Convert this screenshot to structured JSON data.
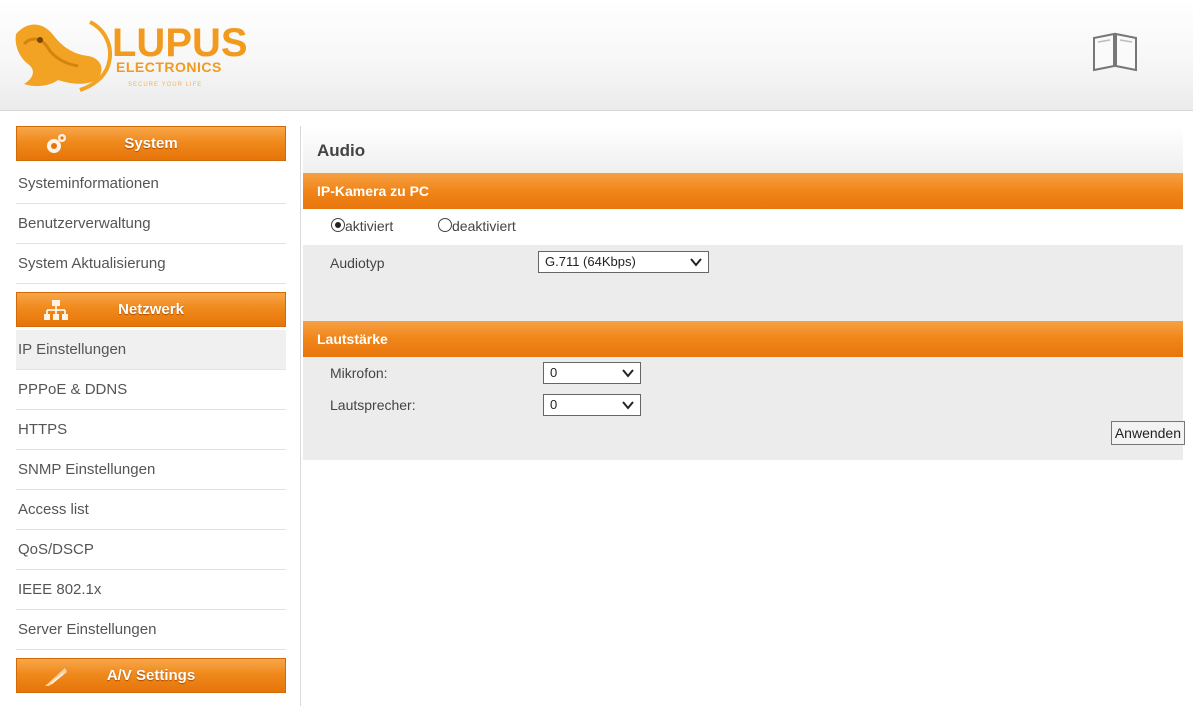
{
  "brand": {
    "name": "LUPUS",
    "sub": "ELECTRONICS",
    "tagline": "SECURE YOUR LIFE"
  },
  "header": {
    "help_icon": "book-icon"
  },
  "sidebar": {
    "sections": [
      {
        "title": "System",
        "icon": "gear-icon",
        "items": [
          "Systeminformationen",
          "Benutzerverwaltung",
          "System Aktualisierung"
        ]
      },
      {
        "title": "Netzwerk",
        "icon": "network-icon",
        "items": [
          "IP Einstellungen",
          "PPPoE & DDNS",
          "HTTPS",
          "SNMP Einstellungen",
          "Access list",
          "QoS/DSCP",
          "IEEE 802.1x",
          "Server Einstellungen"
        ],
        "active": "IP Einstellungen"
      },
      {
        "title": "A/V Settings",
        "icon": "av-icon",
        "items": []
      }
    ]
  },
  "main": {
    "title": "Audio",
    "section1": {
      "title": "IP-Kamera zu PC",
      "radio_on": "aktiviert",
      "radio_off": "deaktiviert",
      "audiotyp_label": "Audiotyp",
      "audiotyp_value": "G.711 (64Kbps)"
    },
    "section2": {
      "title": "Lautstärke",
      "mic_label": "Mikrofon:",
      "mic_value": "0",
      "speaker_label": "Lautsprecher:",
      "speaker_value": "0"
    },
    "apply_label": "Anwenden"
  },
  "colors": {
    "accent": "#f08519",
    "row_grey": "#ececec"
  }
}
